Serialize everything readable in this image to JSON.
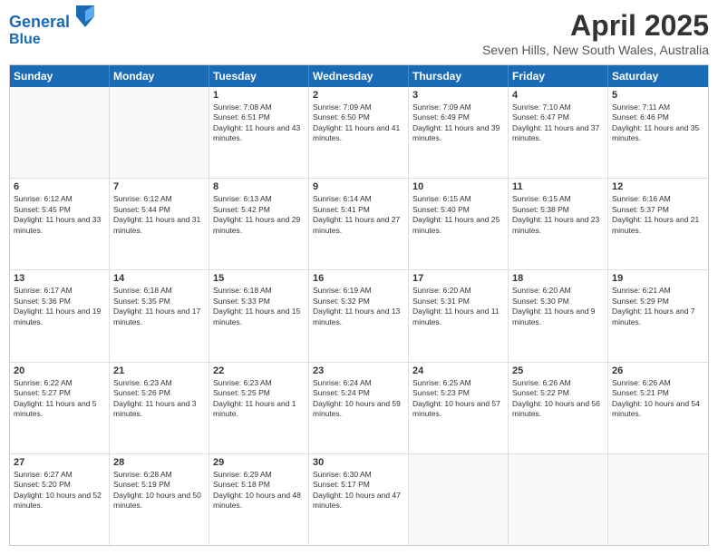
{
  "header": {
    "logo_line1": "General",
    "logo_line2": "Blue",
    "main_title": "April 2025",
    "subtitle": "Seven Hills, New South Wales, Australia"
  },
  "calendar": {
    "days_of_week": [
      "Sunday",
      "Monday",
      "Tuesday",
      "Wednesday",
      "Thursday",
      "Friday",
      "Saturday"
    ],
    "weeks": [
      [
        {
          "day": "",
          "empty": true
        },
        {
          "day": "",
          "empty": true
        },
        {
          "day": "1",
          "sunrise": "Sunrise: 7:08 AM",
          "sunset": "Sunset: 6:51 PM",
          "daylight": "Daylight: 11 hours and 43 minutes."
        },
        {
          "day": "2",
          "sunrise": "Sunrise: 7:09 AM",
          "sunset": "Sunset: 6:50 PM",
          "daylight": "Daylight: 11 hours and 41 minutes."
        },
        {
          "day": "3",
          "sunrise": "Sunrise: 7:09 AM",
          "sunset": "Sunset: 6:49 PM",
          "daylight": "Daylight: 11 hours and 39 minutes."
        },
        {
          "day": "4",
          "sunrise": "Sunrise: 7:10 AM",
          "sunset": "Sunset: 6:47 PM",
          "daylight": "Daylight: 11 hours and 37 minutes."
        },
        {
          "day": "5",
          "sunrise": "Sunrise: 7:11 AM",
          "sunset": "Sunset: 6:46 PM",
          "daylight": "Daylight: 11 hours and 35 minutes."
        }
      ],
      [
        {
          "day": "6",
          "sunrise": "Sunrise: 6:12 AM",
          "sunset": "Sunset: 5:45 PM",
          "daylight": "Daylight: 11 hours and 33 minutes."
        },
        {
          "day": "7",
          "sunrise": "Sunrise: 6:12 AM",
          "sunset": "Sunset: 5:44 PM",
          "daylight": "Daylight: 11 hours and 31 minutes."
        },
        {
          "day": "8",
          "sunrise": "Sunrise: 6:13 AM",
          "sunset": "Sunset: 5:42 PM",
          "daylight": "Daylight: 11 hours and 29 minutes."
        },
        {
          "day": "9",
          "sunrise": "Sunrise: 6:14 AM",
          "sunset": "Sunset: 5:41 PM",
          "daylight": "Daylight: 11 hours and 27 minutes."
        },
        {
          "day": "10",
          "sunrise": "Sunrise: 6:15 AM",
          "sunset": "Sunset: 5:40 PM",
          "daylight": "Daylight: 11 hours and 25 minutes."
        },
        {
          "day": "11",
          "sunrise": "Sunrise: 6:15 AM",
          "sunset": "Sunset: 5:38 PM",
          "daylight": "Daylight: 11 hours and 23 minutes."
        },
        {
          "day": "12",
          "sunrise": "Sunrise: 6:16 AM",
          "sunset": "Sunset: 5:37 PM",
          "daylight": "Daylight: 11 hours and 21 minutes."
        }
      ],
      [
        {
          "day": "13",
          "sunrise": "Sunrise: 6:17 AM",
          "sunset": "Sunset: 5:36 PM",
          "daylight": "Daylight: 11 hours and 19 minutes."
        },
        {
          "day": "14",
          "sunrise": "Sunrise: 6:18 AM",
          "sunset": "Sunset: 5:35 PM",
          "daylight": "Daylight: 11 hours and 17 minutes."
        },
        {
          "day": "15",
          "sunrise": "Sunrise: 6:18 AM",
          "sunset": "Sunset: 5:33 PM",
          "daylight": "Daylight: 11 hours and 15 minutes."
        },
        {
          "day": "16",
          "sunrise": "Sunrise: 6:19 AM",
          "sunset": "Sunset: 5:32 PM",
          "daylight": "Daylight: 11 hours and 13 minutes."
        },
        {
          "day": "17",
          "sunrise": "Sunrise: 6:20 AM",
          "sunset": "Sunset: 5:31 PM",
          "daylight": "Daylight: 11 hours and 11 minutes."
        },
        {
          "day": "18",
          "sunrise": "Sunrise: 6:20 AM",
          "sunset": "Sunset: 5:30 PM",
          "daylight": "Daylight: 11 hours and 9 minutes."
        },
        {
          "day": "19",
          "sunrise": "Sunrise: 6:21 AM",
          "sunset": "Sunset: 5:29 PM",
          "daylight": "Daylight: 11 hours and 7 minutes."
        }
      ],
      [
        {
          "day": "20",
          "sunrise": "Sunrise: 6:22 AM",
          "sunset": "Sunset: 5:27 PM",
          "daylight": "Daylight: 11 hours and 5 minutes."
        },
        {
          "day": "21",
          "sunrise": "Sunrise: 6:23 AM",
          "sunset": "Sunset: 5:26 PM",
          "daylight": "Daylight: 11 hours and 3 minutes."
        },
        {
          "day": "22",
          "sunrise": "Sunrise: 6:23 AM",
          "sunset": "Sunset: 5:25 PM",
          "daylight": "Daylight: 11 hours and 1 minute."
        },
        {
          "day": "23",
          "sunrise": "Sunrise: 6:24 AM",
          "sunset": "Sunset: 5:24 PM",
          "daylight": "Daylight: 10 hours and 59 minutes."
        },
        {
          "day": "24",
          "sunrise": "Sunrise: 6:25 AM",
          "sunset": "Sunset: 5:23 PM",
          "daylight": "Daylight: 10 hours and 57 minutes."
        },
        {
          "day": "25",
          "sunrise": "Sunrise: 6:26 AM",
          "sunset": "Sunset: 5:22 PM",
          "daylight": "Daylight: 10 hours and 56 minutes."
        },
        {
          "day": "26",
          "sunrise": "Sunrise: 6:26 AM",
          "sunset": "Sunset: 5:21 PM",
          "daylight": "Daylight: 10 hours and 54 minutes."
        }
      ],
      [
        {
          "day": "27",
          "sunrise": "Sunrise: 6:27 AM",
          "sunset": "Sunset: 5:20 PM",
          "daylight": "Daylight: 10 hours and 52 minutes."
        },
        {
          "day": "28",
          "sunrise": "Sunrise: 6:28 AM",
          "sunset": "Sunset: 5:19 PM",
          "daylight": "Daylight: 10 hours and 50 minutes."
        },
        {
          "day": "29",
          "sunrise": "Sunrise: 6:29 AM",
          "sunset": "Sunset: 5:18 PM",
          "daylight": "Daylight: 10 hours and 48 minutes."
        },
        {
          "day": "30",
          "sunrise": "Sunrise: 6:30 AM",
          "sunset": "Sunset: 5:17 PM",
          "daylight": "Daylight: 10 hours and 47 minutes."
        },
        {
          "day": "",
          "empty": true
        },
        {
          "day": "",
          "empty": true
        },
        {
          "day": "",
          "empty": true
        }
      ]
    ]
  }
}
